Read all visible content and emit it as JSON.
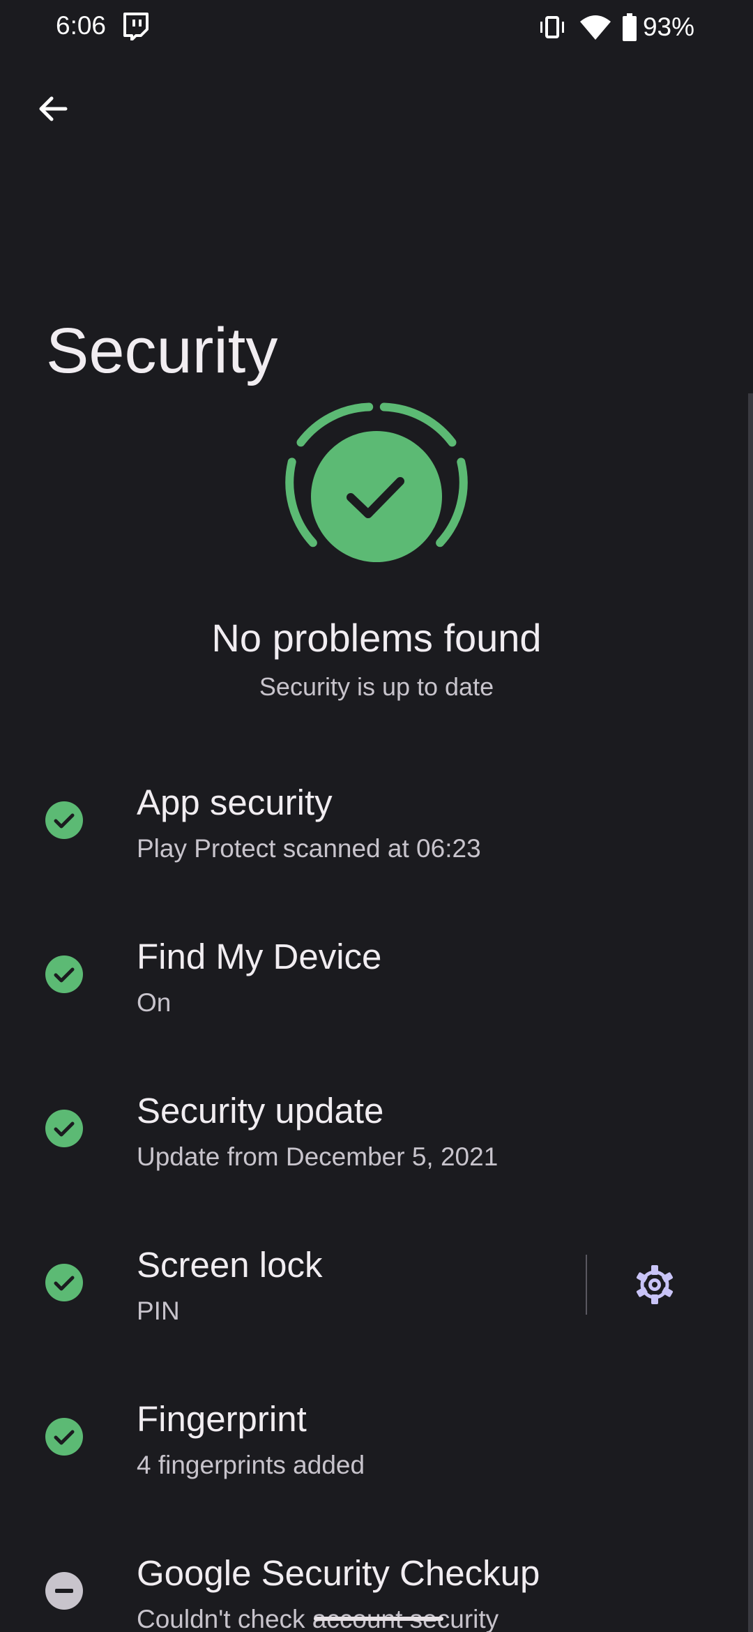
{
  "status_bar": {
    "time": "6:06",
    "battery_percent": "93%",
    "icons": [
      "twitch-notification-icon",
      "vibrate-icon",
      "wifi-icon",
      "battery-icon"
    ]
  },
  "header": {
    "back_icon": "arrow-left-icon",
    "title": "Security"
  },
  "hero": {
    "icon": "shield-check-icon",
    "title": "No problems found",
    "subtitle": "Security is up to date"
  },
  "items": [
    {
      "title": "App security",
      "summary": "Play Protect scanned at 06:23",
      "status": "ok"
    },
    {
      "title": "Find My Device",
      "summary": "On",
      "status": "ok"
    },
    {
      "title": "Security update",
      "summary": "Update from December 5, 2021",
      "status": "ok"
    },
    {
      "title": "Screen lock",
      "summary": "PIN",
      "status": "ok",
      "has_settings": true
    },
    {
      "title": "Fingerprint",
      "summary": "4 fingerprints added",
      "status": "ok"
    },
    {
      "title": "Google Security Checkup",
      "summary": "Couldn't check account security",
      "status": "unknown"
    }
  ],
  "colors": {
    "background": "#1b1b1f",
    "ok_green": "#5cba74",
    "unknown_grey": "#c8c4cc",
    "text_primary": "#f1edf1",
    "text_secondary": "#c8c4cc"
  }
}
